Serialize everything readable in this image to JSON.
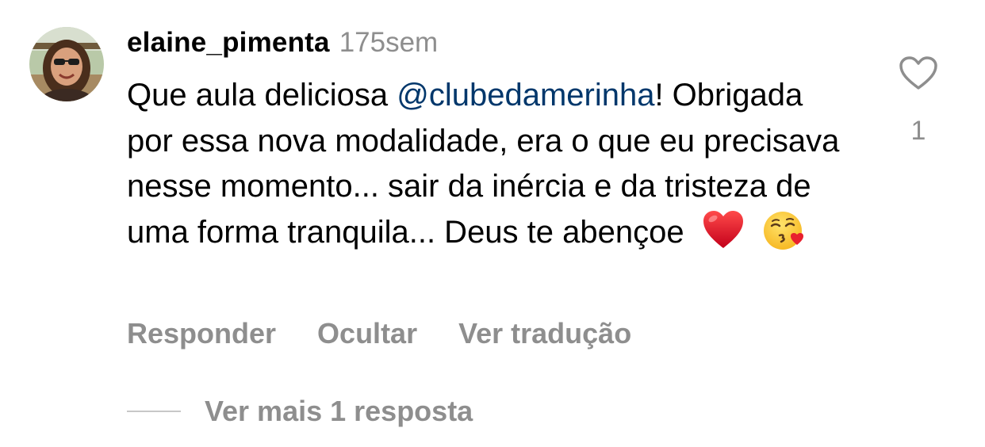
{
  "comment": {
    "username": "elaine_pimenta",
    "timestamp": "175sem",
    "text_before_mention": "Que aula deliciosa ",
    "mention": "@clubedamerinha",
    "text_after_mention": "! Obrigada por essa nova modalidade, era o que eu precisava nesse momento... sair da inércia e da tristeza de uma forma tranquila... Deus te abençoe",
    "emojis": [
      "red-heart",
      "face-blowing-kiss"
    ],
    "like_count": "1",
    "like_icon": "heart-outline-icon"
  },
  "actions": {
    "reply": "Responder",
    "hide": "Ocultar",
    "translate": "Ver tradução"
  },
  "replies": {
    "label": "Ver mais 1 resposta"
  },
  "colors": {
    "mention": "#00376b",
    "secondary_text": "#8e8e8e",
    "primary_text": "#000000"
  }
}
